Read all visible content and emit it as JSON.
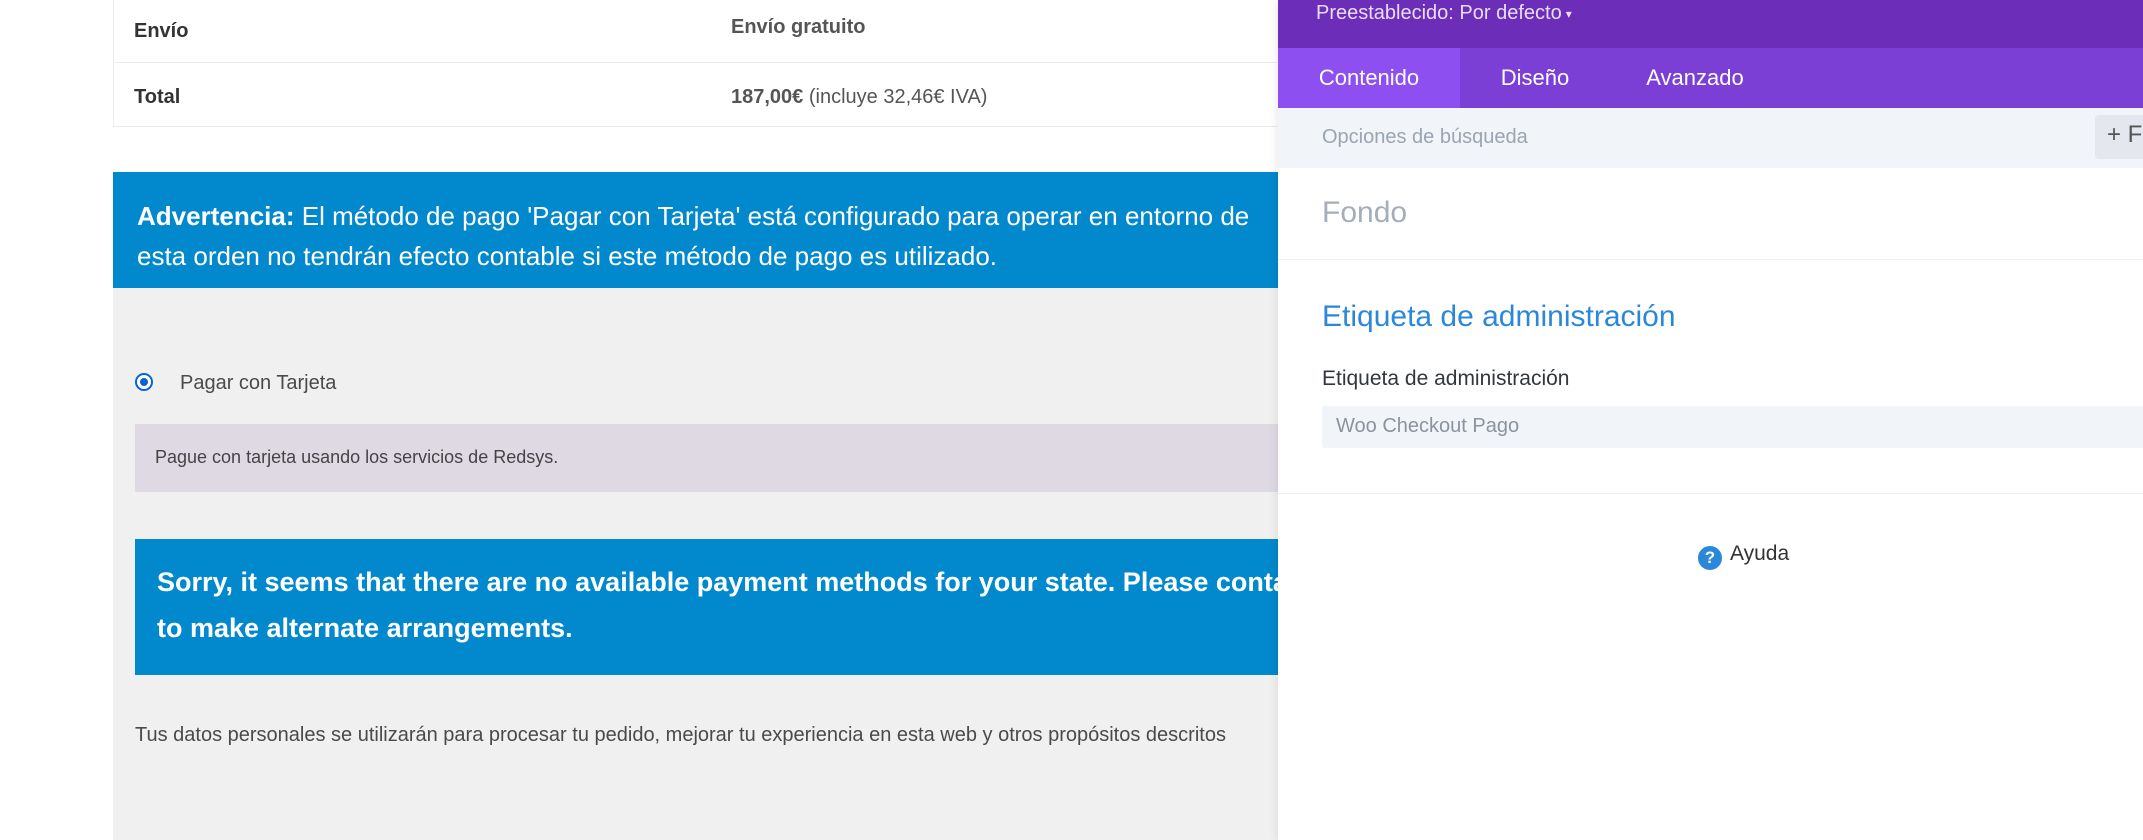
{
  "order_summary": {
    "shipping_label": "Envío",
    "shipping_value": "Envío gratuito",
    "total_label": "Total",
    "total_amount": "187,00€",
    "total_tax_note": " (incluye 32,46€ IVA)"
  },
  "warning": {
    "prefix": "Advertencia:",
    "line1": " El método de pago 'Pagar con Tarjeta' está configurado para operar en entorno de",
    "line2": "esta orden no tendrán efecto contable si este método de pago es utilizado."
  },
  "payment": {
    "method_label": "Pagar con Tarjeta",
    "method_description": "Pague con tarjeta usando los servicios de Redsys."
  },
  "notice": {
    "line1": "Sorry, it seems that there are no available payment methods for your state. Please contact us",
    "line2": "to make alternate arrangements."
  },
  "privacy_text": "Tus datos personales se utilizarán para procesar tu pedido, mejorar tu experiencia en esta web y otros propósitos descritos",
  "panel": {
    "preset_label": "Preestablecido: Por defecto",
    "tabs": [
      {
        "label": "Contenido",
        "active": true
      },
      {
        "label": "Diseño",
        "active": false
      },
      {
        "label": "Avanzado",
        "active": false
      }
    ],
    "search_placeholder": "Opciones de búsqueda",
    "filter_button": "+ F",
    "section_background": "Fondo",
    "section_admin": "Etiqueta de administración",
    "admin_field_label": "Etiqueta de administración",
    "admin_field_value": "Woo Checkout Pago",
    "help_label": "Ayuda"
  },
  "colors": {
    "accent_blue": "#0288cc",
    "panel_purple": "#6c2eb9",
    "tab_active": "#8d4ff0",
    "link_blue": "#2b87da"
  }
}
